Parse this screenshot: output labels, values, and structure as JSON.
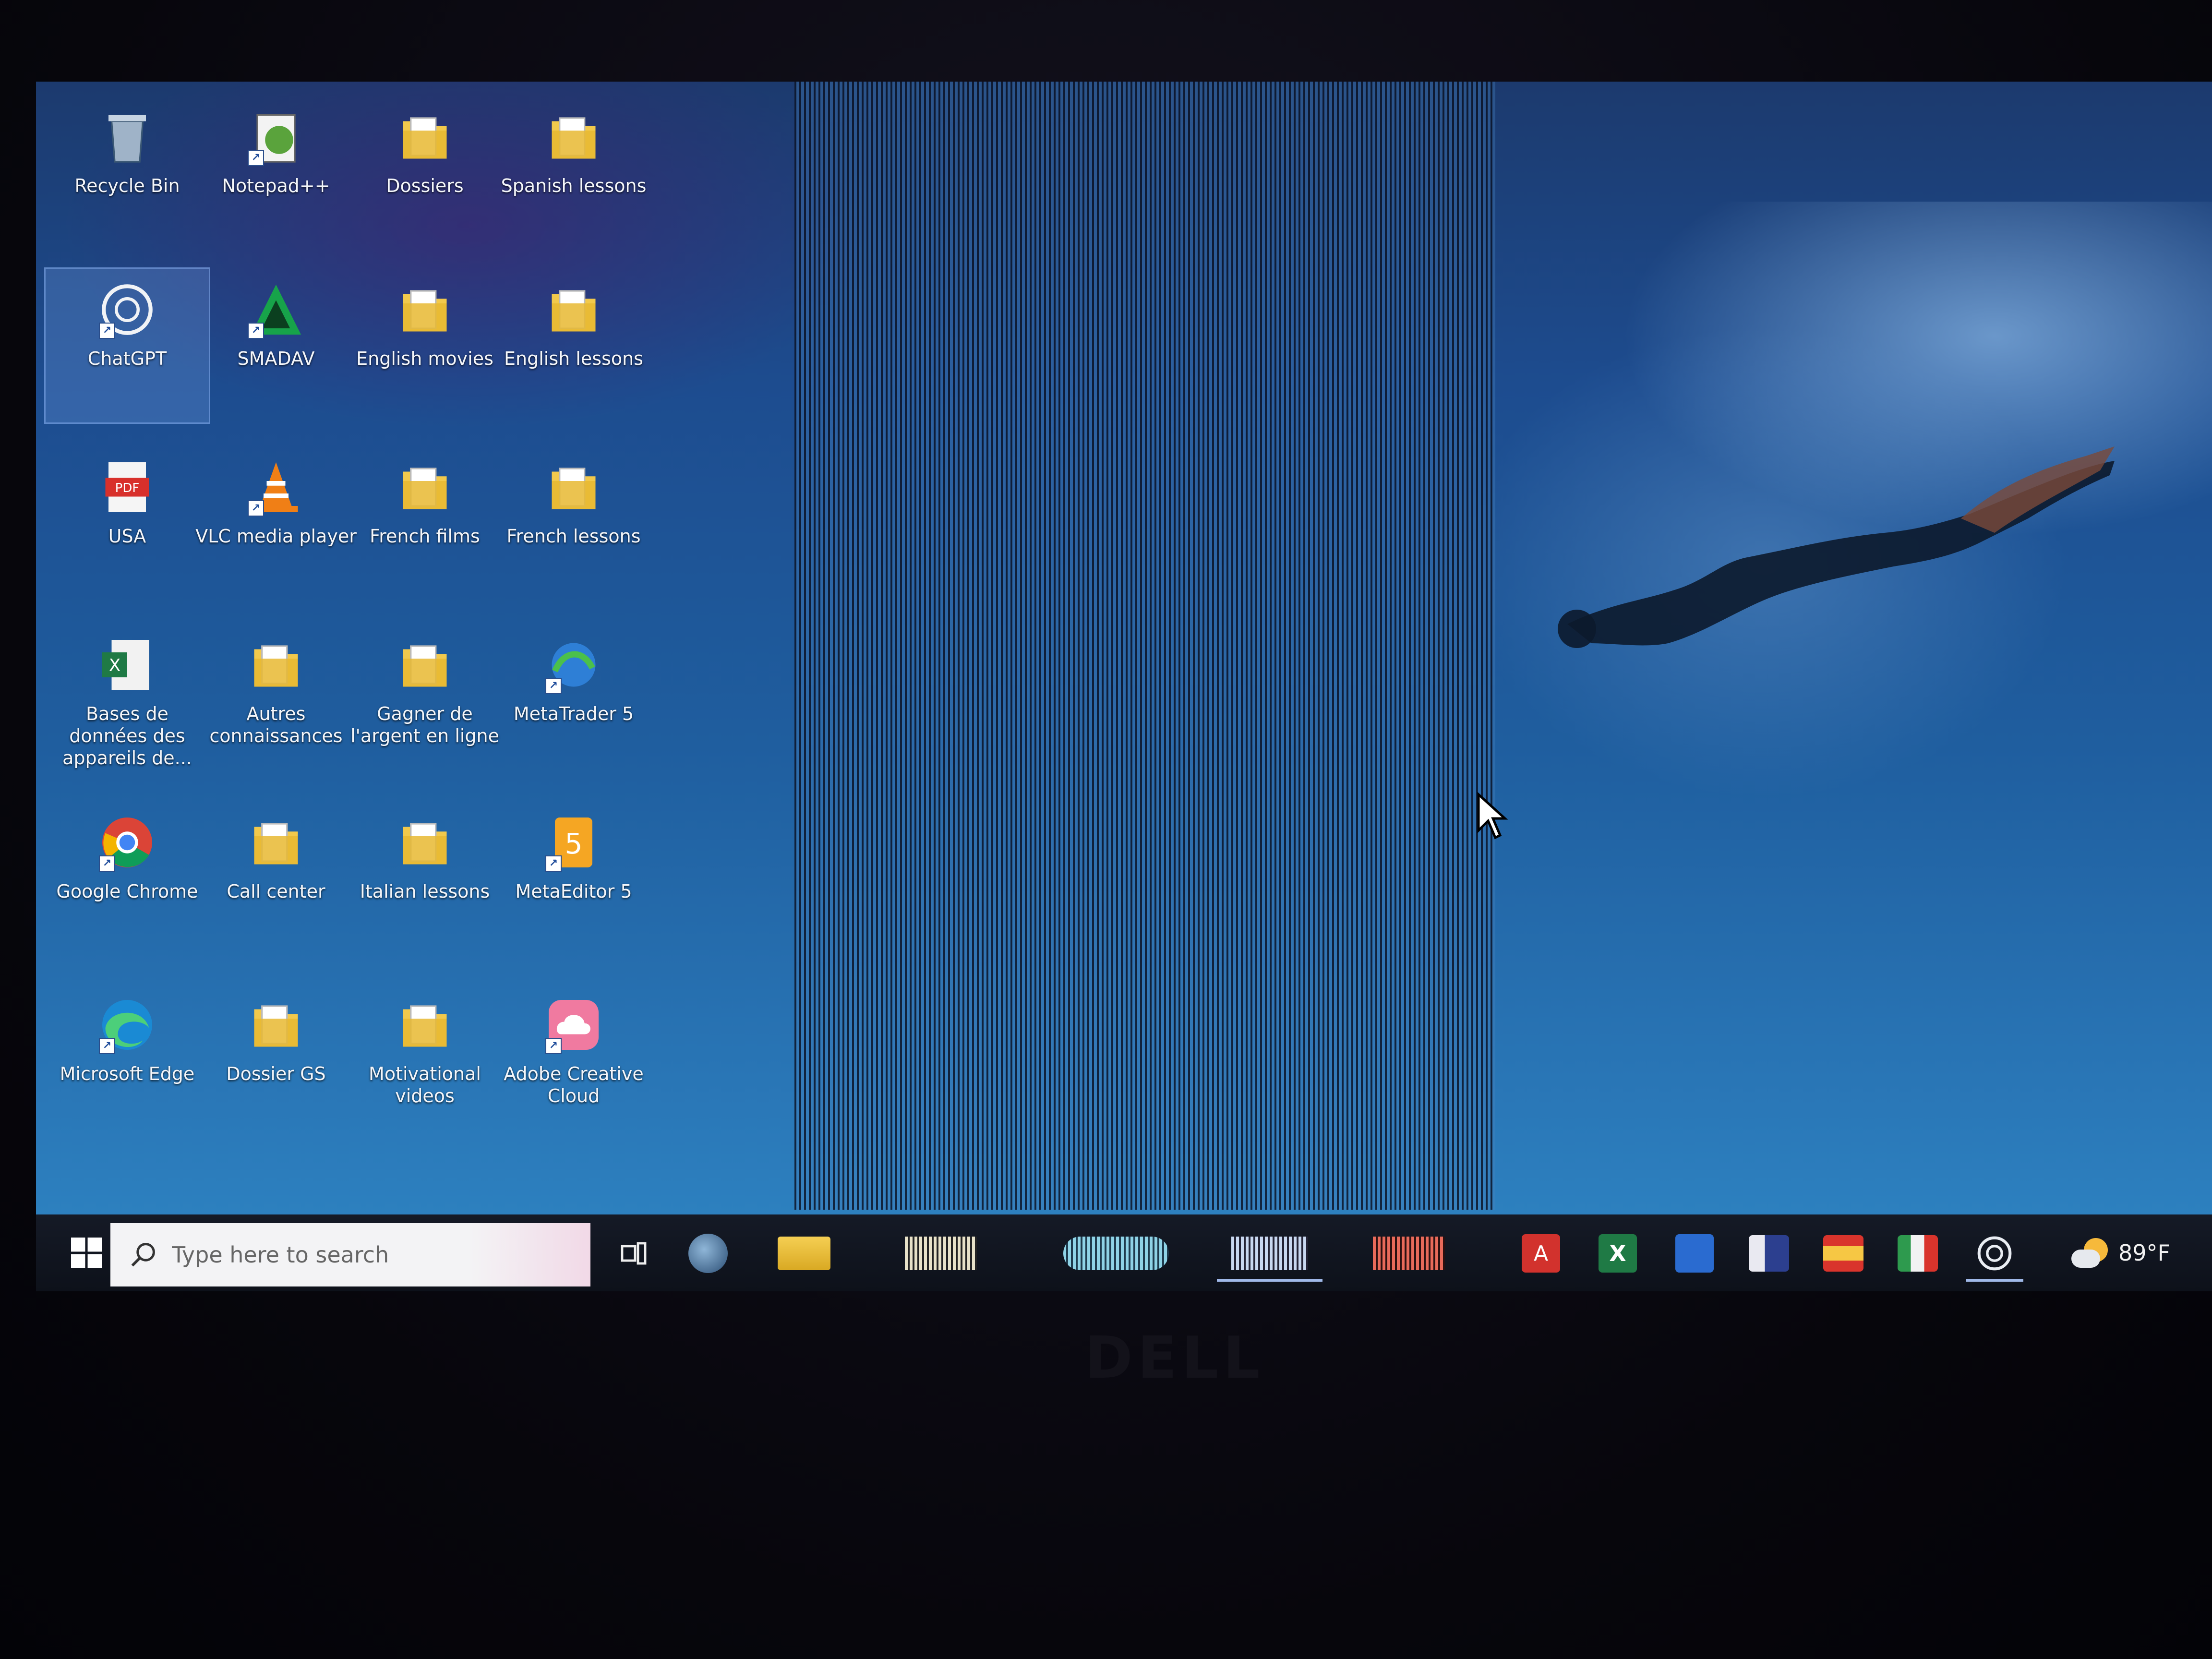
{
  "desktop": {
    "icons": [
      {
        "label": "Recycle Bin",
        "icon": "recycle-bin-icon"
      },
      {
        "label": "Notepad++",
        "icon": "notepad-plus-plus-icon"
      },
      {
        "label": "Dossiers",
        "icon": "folder-icon"
      },
      {
        "label": "Spanish lessons",
        "icon": "folder-icon"
      },
      {
        "label": "ChatGPT",
        "icon": "chatgpt-icon"
      },
      {
        "label": "SMADAV",
        "icon": "smadav-icon"
      },
      {
        "label": "English movies",
        "icon": "folder-icon"
      },
      {
        "label": "English lessons",
        "icon": "folder-icon"
      },
      {
        "label": "USA",
        "icon": "pdf-file-icon"
      },
      {
        "label": "VLC media player",
        "icon": "vlc-cone-icon"
      },
      {
        "label": "French films",
        "icon": "folder-icon"
      },
      {
        "label": "French lessons",
        "icon": "folder-icon"
      },
      {
        "label": "Bases de données des appareils de...",
        "icon": "excel-file-icon"
      },
      {
        "label": "Autres connaissances",
        "icon": "folder-icon"
      },
      {
        "label": "Gagner de l'argent en ligne",
        "icon": "folder-icon"
      },
      {
        "label": "MetaTrader 5",
        "icon": "metatrader-icon"
      },
      {
        "label": "Google Chrome",
        "icon": "chrome-icon"
      },
      {
        "label": "Call center",
        "icon": "folder-icon"
      },
      {
        "label": "Italian lessons",
        "icon": "folder-icon"
      },
      {
        "label": "MetaEditor 5",
        "icon": "metaeditor-icon"
      },
      {
        "label": "Microsoft Edge",
        "icon": "edge-icon"
      },
      {
        "label": "Dossier GS",
        "icon": "folder-icon"
      },
      {
        "label": "Motivational videos",
        "icon": "folder-icon"
      },
      {
        "label": "Adobe Creative Cloud",
        "icon": "creative-cloud-icon"
      }
    ],
    "selected_icon": "ChatGPT"
  },
  "taskbar": {
    "search_placeholder": "Type here to search",
    "apps": [
      {
        "name": "task-view",
        "icon": "task-view-icon"
      },
      {
        "name": "user-photo",
        "icon": "avatar-icon"
      },
      {
        "name": "file-explorer",
        "icon": "folder-icon"
      },
      {
        "name": "app-window-1",
        "icon": "app-icon"
      },
      {
        "name": "app-window-2",
        "icon": "app-icon"
      },
      {
        "name": "app-window-3",
        "icon": "app-icon"
      },
      {
        "name": "app-window-4",
        "icon": "app-icon"
      },
      {
        "name": "acrobat",
        "icon": "acrobat-icon"
      },
      {
        "name": "excel",
        "icon": "excel-icon"
      },
      {
        "name": "word",
        "icon": "word-icon"
      },
      {
        "name": "english-flag-folder",
        "icon": "flag-folder-icon"
      },
      {
        "name": "spanish-flag-folder",
        "icon": "flag-folder-icon"
      },
      {
        "name": "italian-flag-folder",
        "icon": "flag-folder-icon"
      },
      {
        "name": "chatgpt",
        "icon": "chatgpt-icon"
      }
    ],
    "weather_temp": "89°F",
    "weather_icon": "partly-sunny-icon"
  },
  "colors": {
    "accent": "#9fb8e8",
    "taskbar": "#0d111a",
    "desktop": "#1f5e9f"
  }
}
